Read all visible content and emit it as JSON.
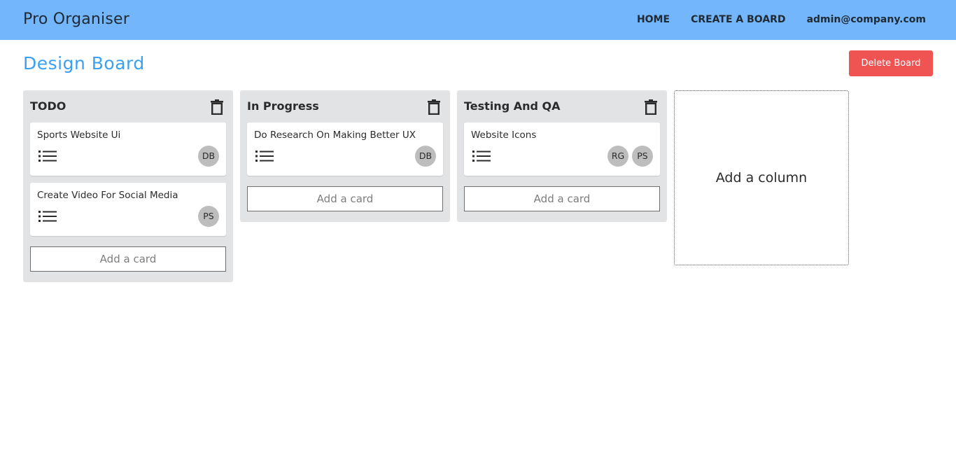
{
  "app": {
    "brand": "Pro Organiser"
  },
  "nav": {
    "home": "HOME",
    "create": "CREATE A BOARD",
    "user": "admin@company.com"
  },
  "board": {
    "title": "Design Board",
    "delete_label": "Delete Board"
  },
  "columns": [
    {
      "title": "TODO",
      "cards": [
        {
          "title": "Sports Website Ui",
          "members": [
            "DB"
          ]
        },
        {
          "title": "Create Video For Social Media",
          "members": [
            "PS"
          ]
        }
      ],
      "add_card_label": "Add a card"
    },
    {
      "title": "In Progress",
      "cards": [
        {
          "title": "Do Research On Making Better UX",
          "members": [
            "DB"
          ]
        }
      ],
      "add_card_label": "Add a card"
    },
    {
      "title": "Testing And QA",
      "cards": [
        {
          "title": "Website Icons",
          "members": [
            "RG",
            "PS"
          ]
        }
      ],
      "add_card_label": "Add a card"
    }
  ],
  "add_column_label": "Add a column",
  "colors": {
    "navbar": "#74b6fc",
    "board_title": "#3ba0f2",
    "delete_button": "#ef5453",
    "column_bg": "#e2e3e5",
    "avatar_bg": "#bdbdbd"
  },
  "icons": {
    "column_delete": "trash-icon",
    "card_details": "list-icon"
  }
}
